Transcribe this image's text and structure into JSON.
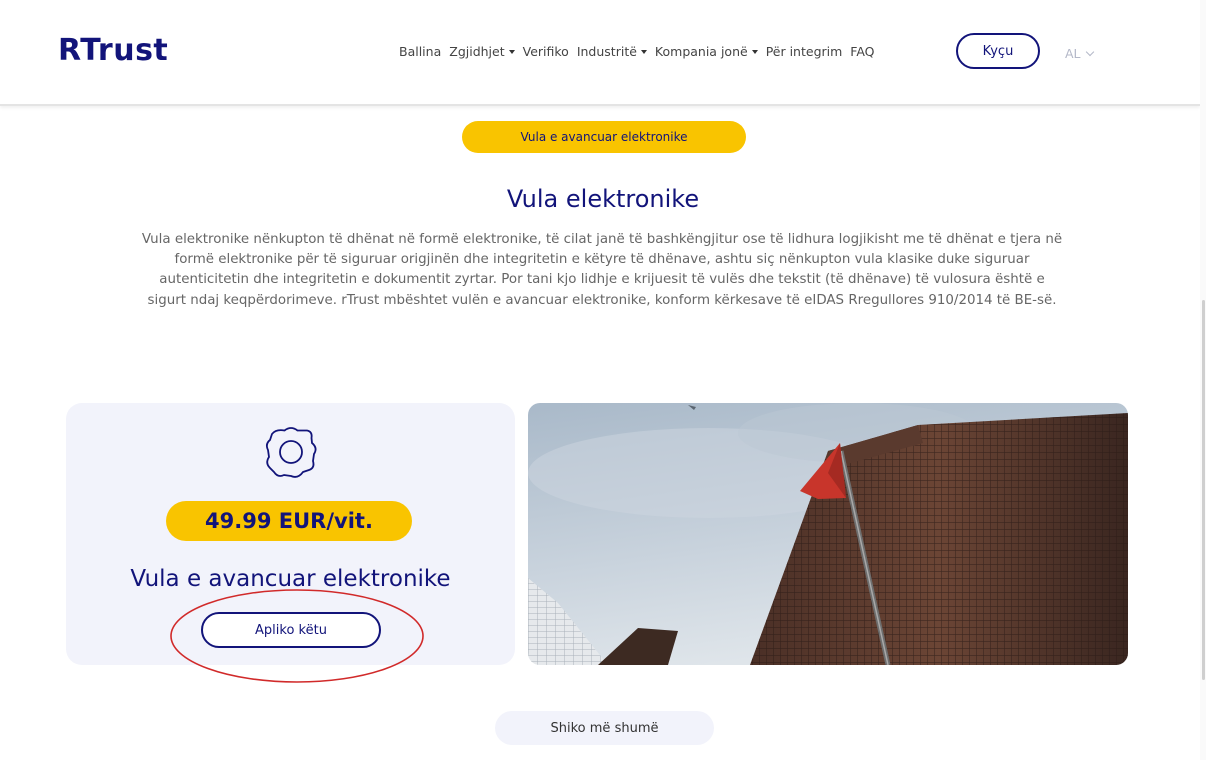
{
  "brand": {
    "logo_text": "RTrust"
  },
  "nav": {
    "items": [
      {
        "label": "Ballina",
        "dropdown": false
      },
      {
        "label": "Zgjidhjet",
        "dropdown": true
      },
      {
        "label": "Verifiko",
        "dropdown": false
      },
      {
        "label": "Industritë",
        "dropdown": true
      },
      {
        "label": "Kompania jonë",
        "dropdown": true
      },
      {
        "label": "Për integrim",
        "dropdown": false
      },
      {
        "label": "FAQ",
        "dropdown": false
      }
    ],
    "login_label": "Kyçu",
    "language": "AL"
  },
  "section": {
    "pill_label": "Vula e avancuar elektronike",
    "title": "Vula elektronike",
    "description": "Vula elektronike nënkupton të dhënat në formë elektronike, të cilat janë të bashkëngjitur ose të lidhura logjikisht me të dhënat e tjera në formë elektronike për të siguruar origjinën dhe integritetin e këtyre të dhënave, ashtu siç nënkupton vula klasike duke siguruar autenticitetin dhe integritetin e dokumentit zyrtar. Por tani kjo lidhje e krijuesit të vulës dhe tekstit (të dhënave) të vulosura është e sigurt ndaj keqpërdorimeve. rTrust mbështet vulën e avancuar elektronike, konform kërkesave të eIDAS Rregullores 910/2014 të BE-së."
  },
  "product_card": {
    "icon": "gear-icon",
    "price": "49.99 EUR/vit.",
    "name": "Vula e avancuar elektronike",
    "apply_label": "Apliko këtu"
  },
  "more_label": "Shiko më shumë",
  "colors": {
    "brand_navy": "#12147a",
    "accent_yellow": "#f9c400",
    "card_bg": "#f2f3fb",
    "annotation_red": "#d12a2a"
  }
}
